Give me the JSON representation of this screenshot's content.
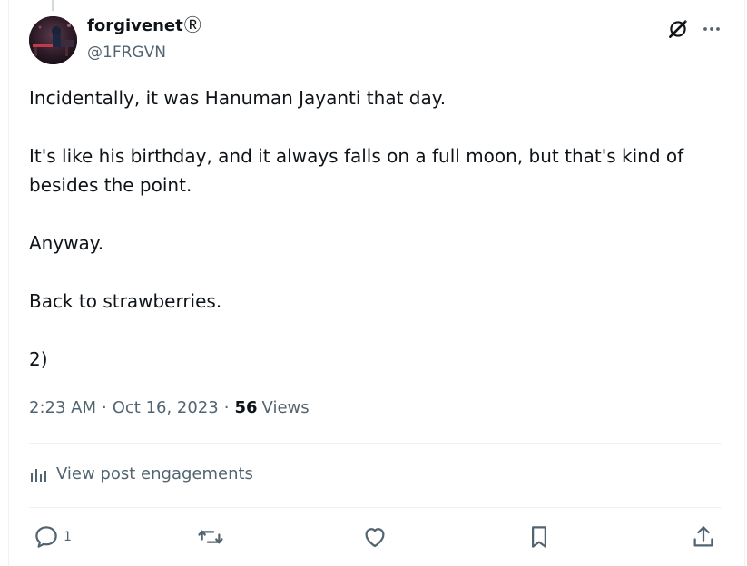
{
  "author": {
    "display_name": "forgivenet",
    "verified_mark": "Ⓡ",
    "handle": "@1FRGVN",
    "avatar_icon": "avatar-image"
  },
  "post": {
    "paragraphs": [
      "Incidentally, it was Hanuman Jayanti that day.",
      "It's like his birthday, and it always falls on a full moon, but that's kind of besides the point.",
      "Anyway.",
      "Back to strawberries.",
      "2)"
    ]
  },
  "meta": {
    "time": "2:23 AM",
    "separator": "·",
    "date": "Oct 16, 2023",
    "views_count": "56",
    "views_label": "Views"
  },
  "engagements": {
    "label": "View post engagements",
    "icon": "analytics-icon"
  },
  "actions": {
    "reply_count": "1",
    "icons": [
      "reply-icon",
      "repost-icon",
      "like-icon",
      "bookmark-icon",
      "share-icon"
    ]
  },
  "colors": {
    "text_primary": "#0f1419",
    "text_secondary": "#536471",
    "divider": "#eff3f4"
  }
}
